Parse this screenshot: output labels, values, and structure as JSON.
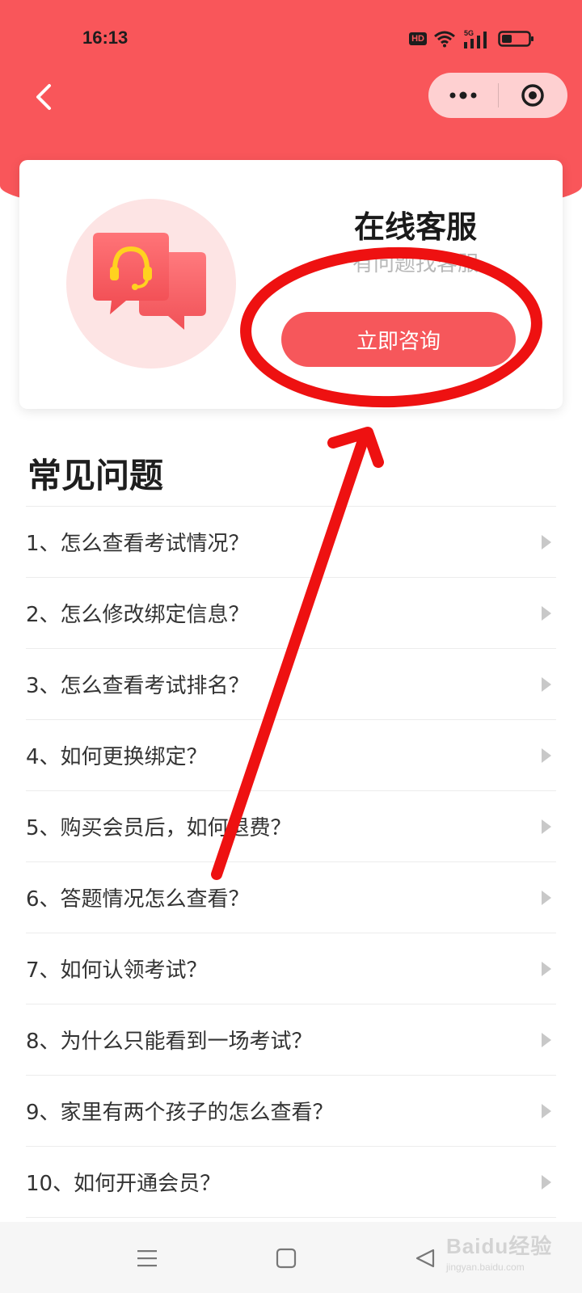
{
  "status_bar": {
    "time": "16:13",
    "badge": "HD",
    "network": "5G",
    "icons": [
      "hd-icon",
      "wifi-icon",
      "signal-5g-icon",
      "battery-icon"
    ]
  },
  "nav": {
    "back_icon": "chevron-left-icon",
    "more_icon": "more-dots-icon",
    "close_icon": "target-close-icon"
  },
  "service": {
    "title": "在线客服",
    "subtitle": "有问题找客服",
    "button_label": "立即咨询",
    "icon": "headset-chat-icon"
  },
  "faq": {
    "heading": "常见问题",
    "items": [
      "1、怎么查看考试情况？",
      "2、怎么修改绑定信息？",
      "3、怎么查看考试排名？",
      "4、如何更换绑定？",
      "5、购买会员后，如何退费？",
      "6、答题情况怎么查看？",
      "7、如何认领考试？",
      "8、为什么只能看到一场考试？",
      "9、家里有两个孩子的怎么查看？",
      "10、如何开通会员？"
    ]
  },
  "bottom_nav": {
    "icons": [
      "menu-icon",
      "home-square-icon",
      "back-triangle-icon"
    ]
  },
  "watermark": {
    "main": "Baidu经验",
    "sub": "jingyan.baidu.com"
  },
  "colors": {
    "brand": "#f9565a",
    "button": "#f6575b",
    "annotation": "#ee1111"
  }
}
